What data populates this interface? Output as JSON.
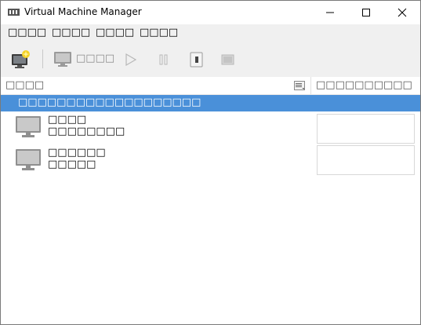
{
  "window": {
    "title": "Virtual Machine Manager",
    "minimize_glyph": "—",
    "maximize_glyph": "☐",
    "close_glyph": "✕"
  },
  "menu": [
    {
      "label": "□□□□"
    },
    {
      "label": "□□□□"
    },
    {
      "label": "□□□□"
    },
    {
      "label": "□□□□"
    }
  ],
  "toolbar": {
    "open_label": "□□□□",
    "icons": [
      "new-vm-icon",
      "monitor-icon",
      "run-icon",
      "pause-icon",
      "shutdown-icon",
      "console-icon"
    ]
  },
  "columns": {
    "name": "□□□□",
    "cpu_usage": "□□□□□□□□□□"
  },
  "connection": {
    "label": "□□□□□□□□□□□□□□□□□□□"
  },
  "vms": [
    {
      "name": "□□□□",
      "status": "□□□□□□□□",
      "icon": "monitor-icon"
    },
    {
      "name": "□□□□□□",
      "status": "□□□□□",
      "icon": "monitor-icon"
    }
  ],
  "colors": {
    "selection": "#4a90d9",
    "chrome": "#f0f0f0"
  }
}
